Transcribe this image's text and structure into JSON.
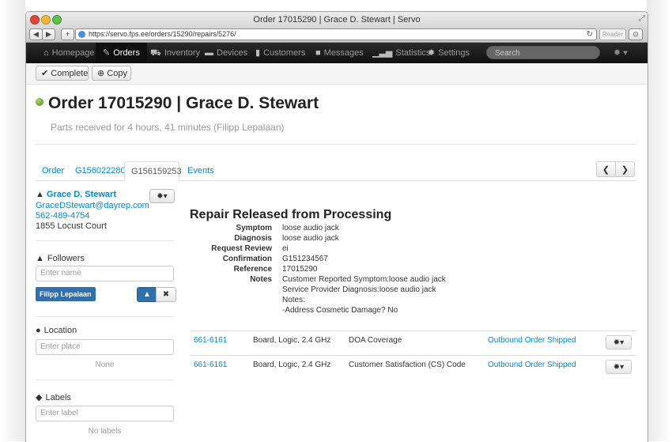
{
  "window": {
    "title": "Order 17015290 | Grace D. Stewart | Servo",
    "url": "https://servo.fps.ee/orders/15290/repairs/5276/",
    "reader_label": "Reader"
  },
  "nav": {
    "items": [
      {
        "label": "Homepage",
        "icon": "home-icon"
      },
      {
        "label": "Orders",
        "icon": "wrench-icon",
        "active": true
      },
      {
        "label": "Inventory",
        "icon": "cart-icon"
      },
      {
        "label": "Devices",
        "icon": "laptop-icon"
      },
      {
        "label": "Customers",
        "icon": "book-icon"
      },
      {
        "label": "Messages",
        "icon": "comment-icon"
      },
      {
        "label": "Statistics",
        "icon": "signal-icon"
      },
      {
        "label": "Settings",
        "icon": "cog-icon"
      }
    ],
    "search_placeholder": "Search"
  },
  "actions": {
    "complete_label": "Complete",
    "copy_label": "Copy"
  },
  "order": {
    "title": "Order 17015290 | Grace D. Stewart",
    "status_text": "Parts received for 4 hours, 41 minutes (Filipp Lepalaan)",
    "status_color": "#6aa829"
  },
  "tabs": [
    {
      "label": "Order"
    },
    {
      "label": "G156022280"
    },
    {
      "label": "G156159253",
      "active": true
    },
    {
      "label": "Events"
    }
  ],
  "customer": {
    "name": "Grace D. Stewart",
    "email": "GraceDStewart@dayrep.com",
    "phone": "562-489-4754",
    "address": "1855 Locust Court"
  },
  "followers": {
    "heading": "Followers",
    "placeholder": "Enter name",
    "chip": "Filipp Lepalaan"
  },
  "location": {
    "heading": "Location",
    "placeholder": "Enter place",
    "empty": "None"
  },
  "labels": {
    "heading": "Labels",
    "placeholder": "Enter label",
    "empty": "No labels"
  },
  "repair": {
    "title": "Repair Released from Processing",
    "fields": [
      {
        "key": "Symptom",
        "value": "loose audio jack"
      },
      {
        "key": "Diagnosis",
        "value": "loose audio jack"
      },
      {
        "key": "Request Review",
        "value": "ei"
      },
      {
        "key": "Confirmation",
        "value": "G151234567"
      },
      {
        "key": "Reference",
        "value": "17015290"
      }
    ],
    "notes_key": "Notes",
    "notes": [
      "Customer Reported Symptom:loose audio jack",
      "Service Provider Diagnosis:loose audio jack",
      "Notes:",
      "-Address Cosmetic Damage? No"
    ],
    "parts": [
      {
        "code": "661-6161",
        "desc": "Board, Logic, 2.4 GHz",
        "coverage": "DOA Coverage",
        "status": "Outbound Order Shipped"
      },
      {
        "code": "661-6161",
        "desc": "Board, Logic, 2.4 GHz",
        "coverage": "Customer Satisfaction (CS) Code",
        "status": "Outbound Order Shipped"
      }
    ]
  }
}
